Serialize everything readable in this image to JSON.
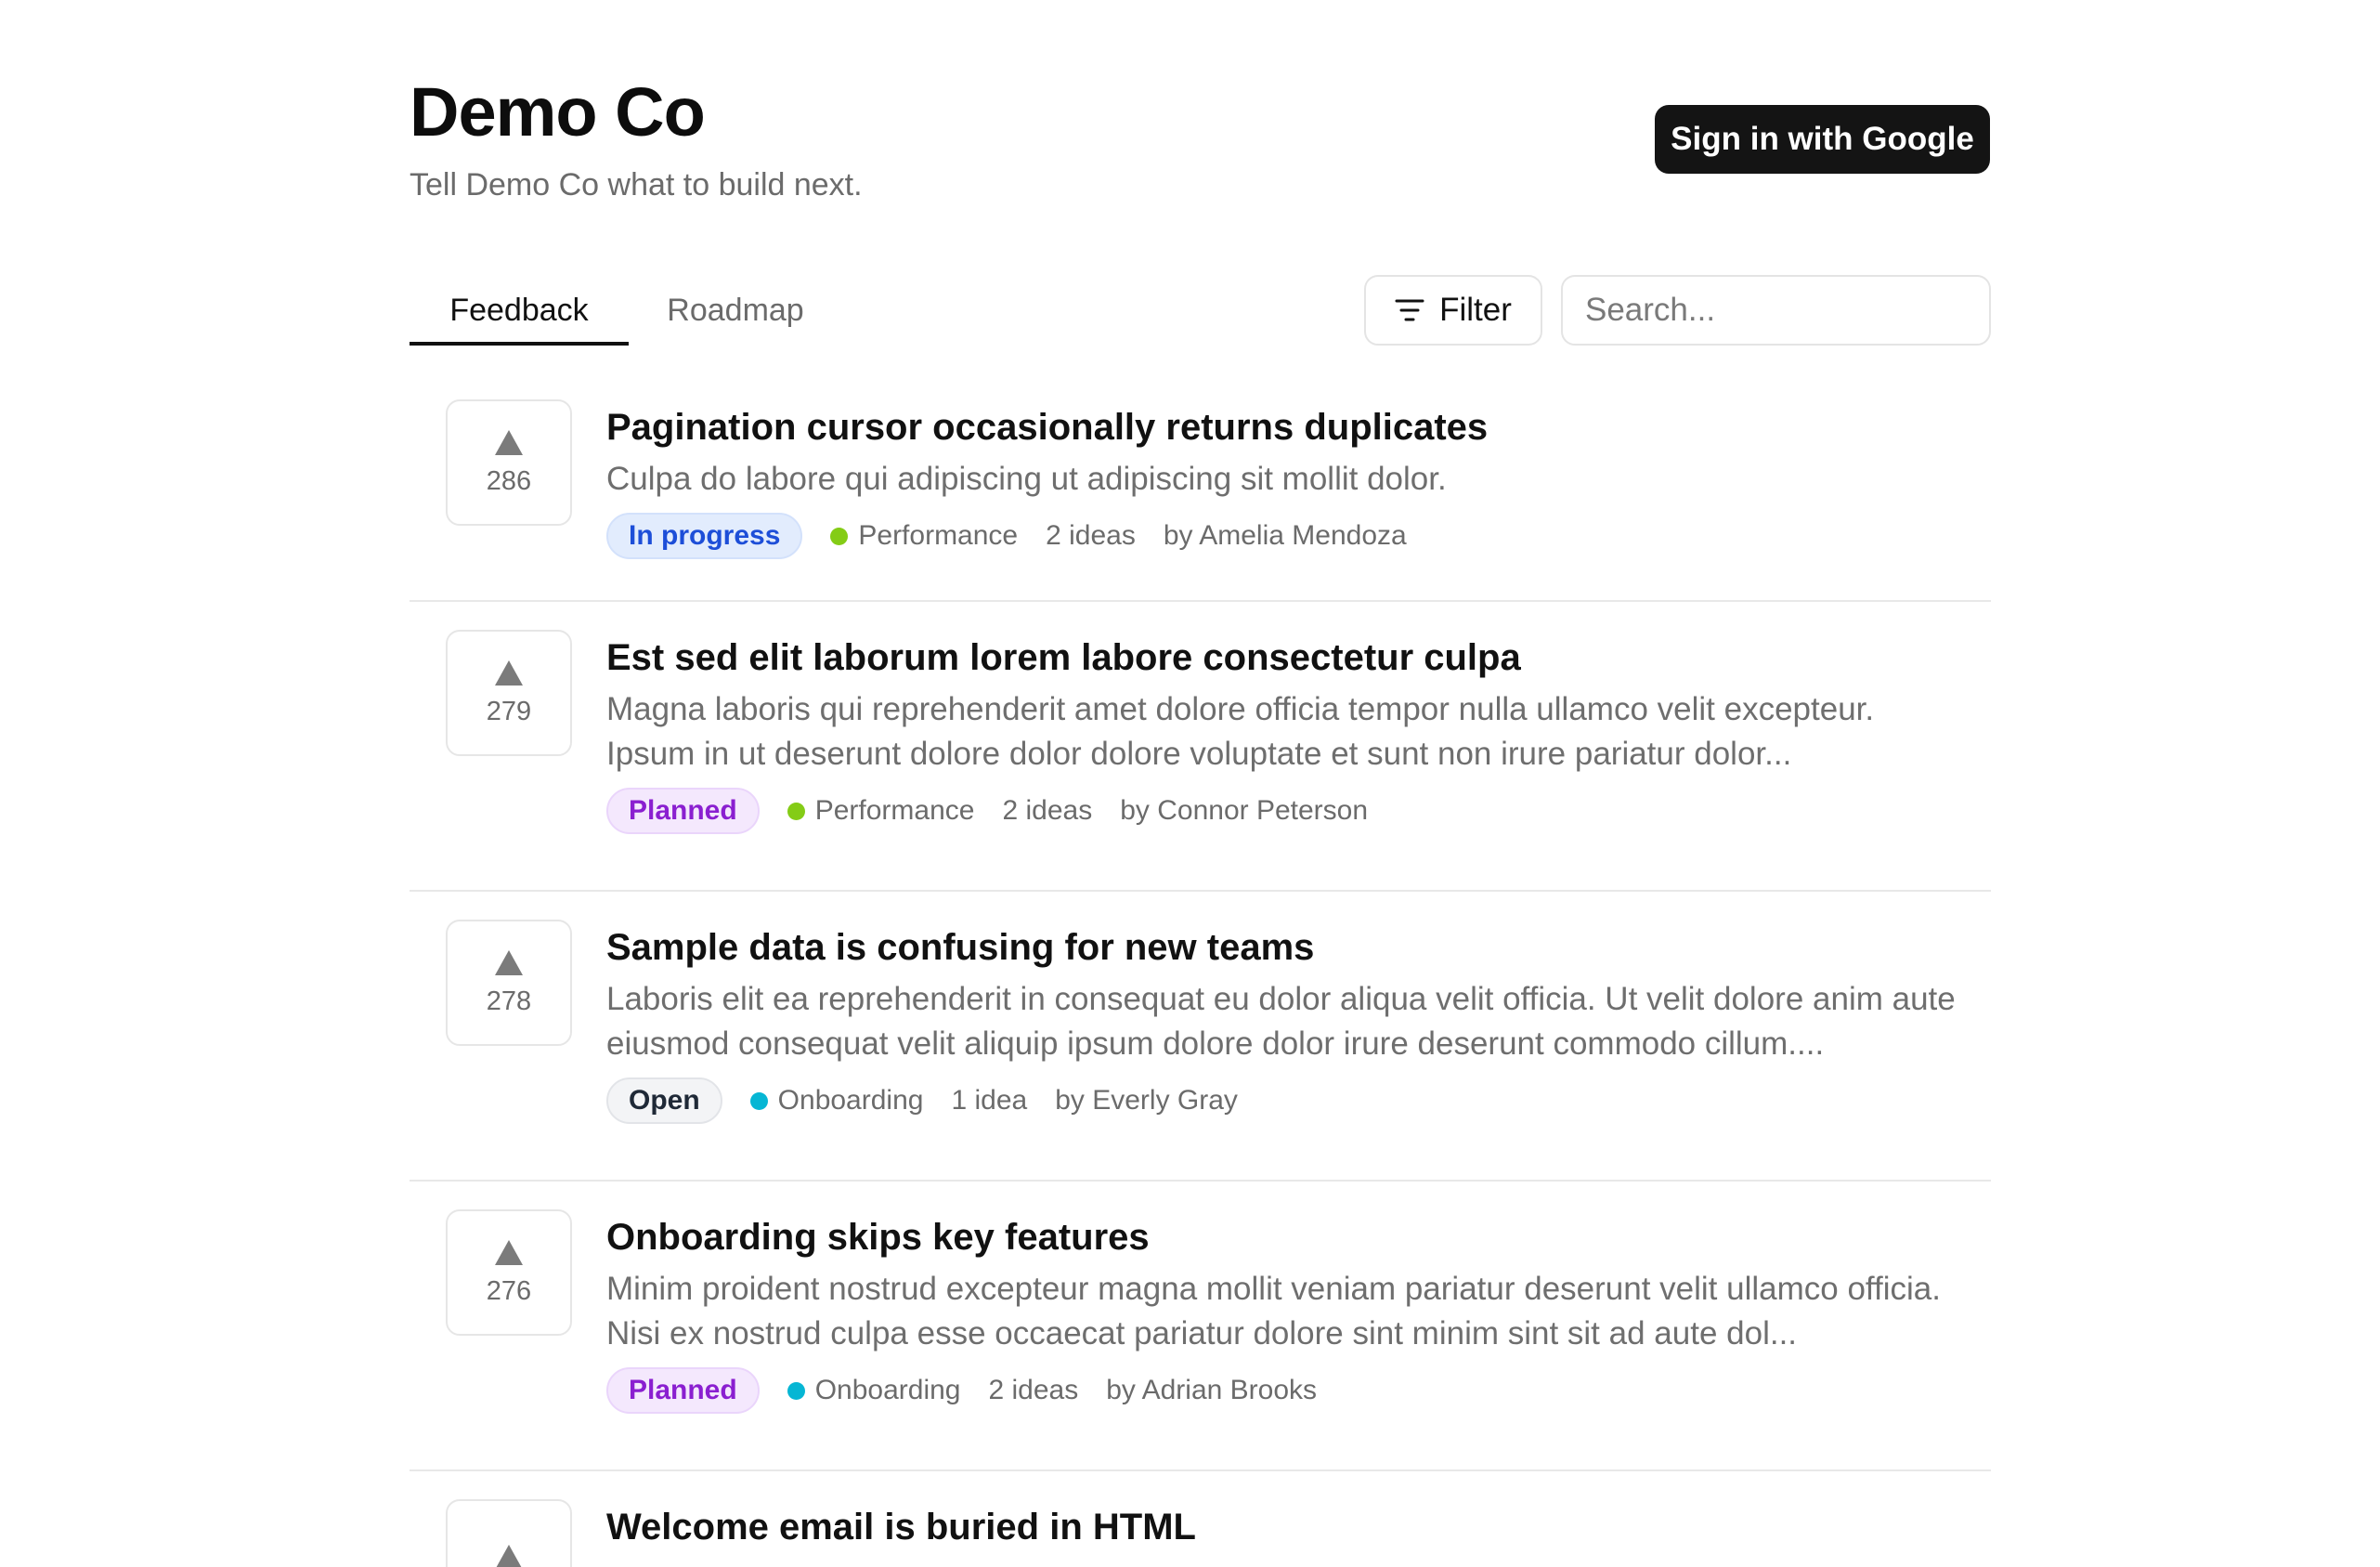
{
  "brand": {
    "title": "Demo Co",
    "tagline": "Tell Demo Co what to build next."
  },
  "auth": {
    "signin_label": "Sign in with Google"
  },
  "tabs": [
    {
      "label": "Feedback",
      "active": true
    },
    {
      "label": "Roadmap",
      "active": false
    }
  ],
  "toolbar": {
    "filter_label": "Filter",
    "filter_icon": "filter-lines-icon",
    "search_placeholder": "Search..."
  },
  "colors": {
    "performance": "#84cc16",
    "onboarding": "#06b6d4"
  },
  "items": [
    {
      "votes": "286",
      "title": "Pagination cursor occasionally returns duplicates",
      "description": "Culpa do labore qui adipiscing ut adipiscing sit mollit dolor.",
      "status": "In progress",
      "category": "Performance",
      "ideas": "2 ideas",
      "author": "by Amelia Mendoza"
    },
    {
      "votes": "279",
      "title": "Est sed elit laborum lorem labore consectetur culpa",
      "description": "Magna laboris qui reprehenderit amet dolore officia tempor nulla ullamco velit excepteur. Ipsum in ut deserunt dolore dolor dolore voluptate et sunt non irure pariatur dolor...",
      "status": "Planned",
      "category": "Performance",
      "ideas": "2 ideas",
      "author": "by Connor Peterson"
    },
    {
      "votes": "278",
      "title": "Sample data is confusing for new teams",
      "description": "Laboris elit ea reprehenderit in consequat eu dolor aliqua velit officia. Ut velit dolore anim aute eiusmod consequat velit aliquip ipsum dolore dolor irure deserunt commodo cillum....",
      "status": "Open",
      "category": "Onboarding",
      "ideas": "1 idea",
      "author": "by Everly Gray"
    },
    {
      "votes": "276",
      "title": "Onboarding skips key features",
      "description": "Minim proident nostrud excepteur magna mollit veniam pariatur deserunt velit ullamco officia. Nisi ex nostrud culpa esse occaecat pariatur dolore sint minim sint sit ad aute dol...",
      "status": "Planned",
      "category": "Onboarding",
      "ideas": "2 ideas",
      "author": "by Adrian Brooks"
    },
    {
      "votes": "",
      "title": "Welcome email is buried in HTML",
      "description": "",
      "status": "",
      "category": "",
      "ideas": "",
      "author": ""
    }
  ]
}
